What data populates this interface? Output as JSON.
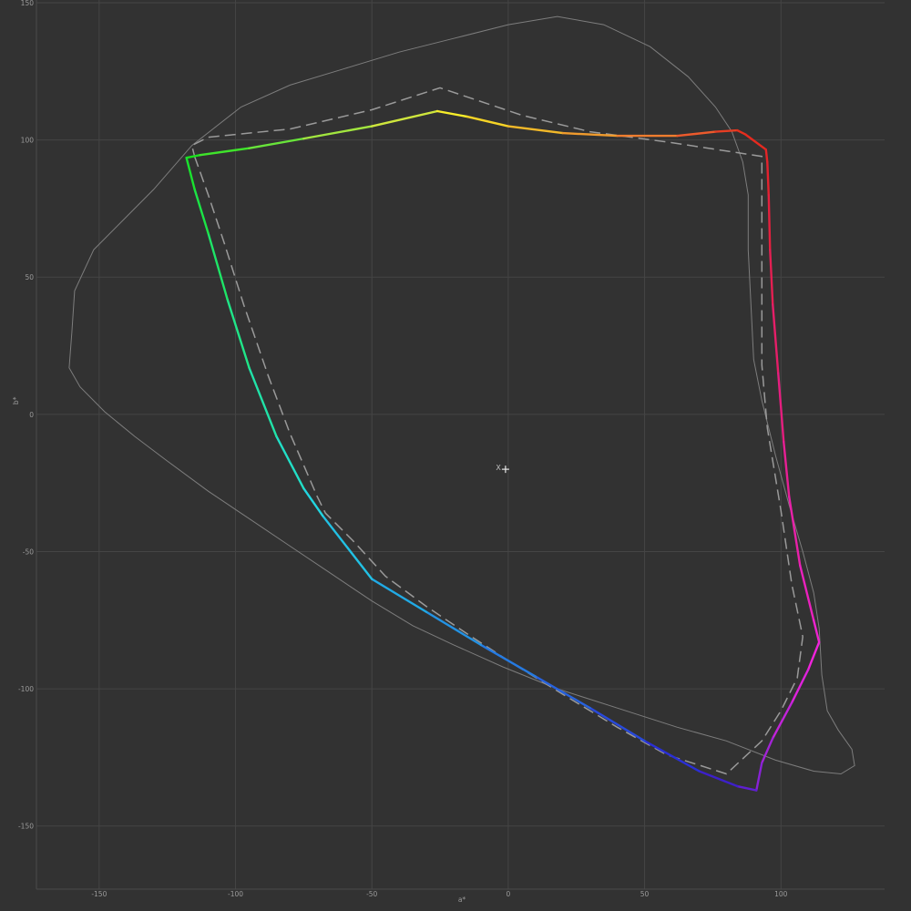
{
  "chart_data": {
    "type": "line",
    "xlabel": "a*",
    "ylabel": "b*",
    "xlim": [
      -173,
      138
    ],
    "ylim": [
      -173,
      151
    ],
    "xticks": [
      -150,
      -100,
      -50,
      0,
      50,
      100
    ],
    "yticks": [
      150,
      100,
      50,
      0,
      -50,
      -100,
      -150
    ],
    "grid": true,
    "whitepoint": {
      "x": -1,
      "y": -20,
      "label": "X"
    },
    "series": [
      {
        "style": "thin-gray",
        "color": "#7d7d7d",
        "points": [
          [
            -160,
            30
          ],
          [
            -161,
            17
          ],
          [
            -157,
            10
          ],
          [
            -148,
            1
          ],
          [
            -137,
            -8
          ],
          [
            -125,
            -17
          ],
          [
            -110,
            -28
          ],
          [
            -95,
            -38
          ],
          [
            -80,
            -48
          ],
          [
            -65,
            -58
          ],
          [
            -50,
            -68
          ],
          [
            -35,
            -77
          ],
          [
            -20,
            -84
          ],
          [
            -2,
            -92
          ],
          [
            18,
            -100
          ],
          [
            40,
            -107
          ],
          [
            62,
            -114
          ],
          [
            80,
            -119
          ],
          [
            98,
            -126
          ],
          [
            112,
            -130
          ],
          [
            122,
            -131
          ],
          [
            127,
            -128
          ],
          [
            126,
            -122
          ],
          [
            121,
            -115
          ],
          [
            117,
            -108
          ],
          [
            115,
            -95
          ],
          [
            114,
            -78
          ],
          [
            112,
            -65
          ],
          [
            108,
            -50
          ],
          [
            103,
            -33
          ],
          [
            98,
            -15
          ],
          [
            93,
            5
          ],
          [
            90,
            20
          ],
          [
            89,
            40
          ],
          [
            88,
            60
          ],
          [
            88,
            80
          ],
          [
            86,
            92
          ],
          [
            82,
            103
          ],
          [
            76,
            112
          ],
          [
            66,
            123
          ],
          [
            52,
            134
          ],
          [
            35,
            142
          ],
          [
            18,
            145
          ],
          [
            0,
            142
          ],
          [
            -20,
            137
          ],
          [
            -40,
            132
          ],
          [
            -60,
            126
          ],
          [
            -80,
            120
          ],
          [
            -98,
            112
          ],
          [
            -116,
            98
          ],
          [
            -130,
            82
          ],
          [
            -142,
            70
          ],
          [
            -152,
            60
          ],
          [
            -159,
            45
          ],
          [
            -160,
            30
          ]
        ]
      },
      {
        "style": "dashed",
        "color": "#9a9a9a",
        "points": [
          [
            -115,
            94
          ],
          [
            -110,
            80
          ],
          [
            -104,
            62
          ],
          [
            -97,
            40
          ],
          [
            -88,
            14
          ],
          [
            -80,
            -7
          ],
          [
            -70,
            -30
          ],
          [
            -67,
            -36
          ],
          [
            -57,
            -46
          ],
          [
            -45,
            -59
          ],
          [
            -30,
            -70
          ],
          [
            -15,
            -80
          ],
          [
            2,
            -91
          ],
          [
            20,
            -102
          ],
          [
            40,
            -114
          ],
          [
            58,
            -124
          ],
          [
            80,
            -131
          ],
          [
            93,
            -119
          ],
          [
            100,
            -108
          ],
          [
            106,
            -96
          ],
          [
            108,
            -81
          ],
          [
            104,
            -62
          ],
          [
            100,
            -35
          ],
          [
            95,
            -5
          ],
          [
            93,
            18
          ],
          [
            93,
            55
          ],
          [
            93,
            94
          ],
          [
            60,
            99
          ],
          [
            30,
            103
          ],
          [
            5,
            109
          ],
          [
            -25,
            119
          ],
          [
            -50,
            111
          ],
          [
            -80,
            104
          ],
          [
            -110,
            101
          ],
          [
            -116,
            98
          ],
          [
            -115,
            94
          ]
        ]
      },
      {
        "style": "gamut-colored",
        "color": "#dddddd",
        "points": [
          [
            -118,
            93.5,
            "#19e01c"
          ],
          [
            -113,
            94.5,
            "#3fe42b"
          ],
          [
            -95,
            97,
            "#68e43a"
          ],
          [
            -75,
            100.5,
            "#a2e63f"
          ],
          [
            -50,
            105,
            "#cfe63d"
          ],
          [
            -26,
            110.5,
            "#f7ee2a"
          ],
          [
            -15,
            108.5,
            "#f6d426"
          ],
          [
            0,
            105,
            "#f3b929"
          ],
          [
            20,
            102.5,
            "#f09b2d"
          ],
          [
            40,
            101.5,
            "#ef7d2e"
          ],
          [
            62,
            101.5,
            "#ec5a2c"
          ],
          [
            76,
            103,
            "#e63d23"
          ],
          [
            84,
            103.5,
            "#e5301d"
          ],
          [
            87,
            102,
            "#e52a1f"
          ],
          [
            94.5,
            96.5,
            "#e42427"
          ],
          [
            95,
            92,
            "#e4222e"
          ],
          [
            95.5,
            80,
            "#e4203e"
          ],
          [
            96,
            60,
            "#e41f52"
          ],
          [
            97,
            40,
            "#e51e68"
          ],
          [
            99,
            15,
            "#e51e7f"
          ],
          [
            101,
            -10,
            "#e71f95"
          ],
          [
            103,
            -30,
            "#e821a9"
          ],
          [
            107,
            -55,
            "#ea21bd"
          ],
          [
            112,
            -75,
            "#ee23d0"
          ],
          [
            114,
            -83,
            "#f123dc"
          ],
          [
            110,
            -93,
            "#df22dc"
          ],
          [
            104,
            -105,
            "#c223d9"
          ],
          [
            97,
            -118,
            "#a323d6"
          ],
          [
            93,
            -127,
            "#8822d4"
          ],
          [
            91,
            -137,
            "#5f1fd1"
          ],
          [
            84,
            -135.5,
            "#3d20c9"
          ],
          [
            70,
            -130,
            "#2a2fd5"
          ],
          [
            50,
            -119,
            "#2849da"
          ],
          [
            30,
            -107,
            "#2762de"
          ],
          [
            10,
            -95.5,
            "#257ae1"
          ],
          [
            -10,
            -84,
            "#2392e3"
          ],
          [
            -30,
            -72,
            "#21aae5"
          ],
          [
            -50,
            -60,
            "#22c1e4"
          ],
          [
            -68,
            -37,
            "#22d5e0"
          ],
          [
            -75,
            -27,
            "#22dec6"
          ],
          [
            -85,
            -8,
            "#21e2a8"
          ],
          [
            -95,
            17,
            "#20e588"
          ],
          [
            -103,
            42,
            "#1ee567"
          ],
          [
            -110,
            66,
            "#1be446"
          ],
          [
            -115,
            82,
            "#1ae22e"
          ],
          [
            -118,
            93.5,
            "#19e01c"
          ]
        ]
      }
    ]
  }
}
